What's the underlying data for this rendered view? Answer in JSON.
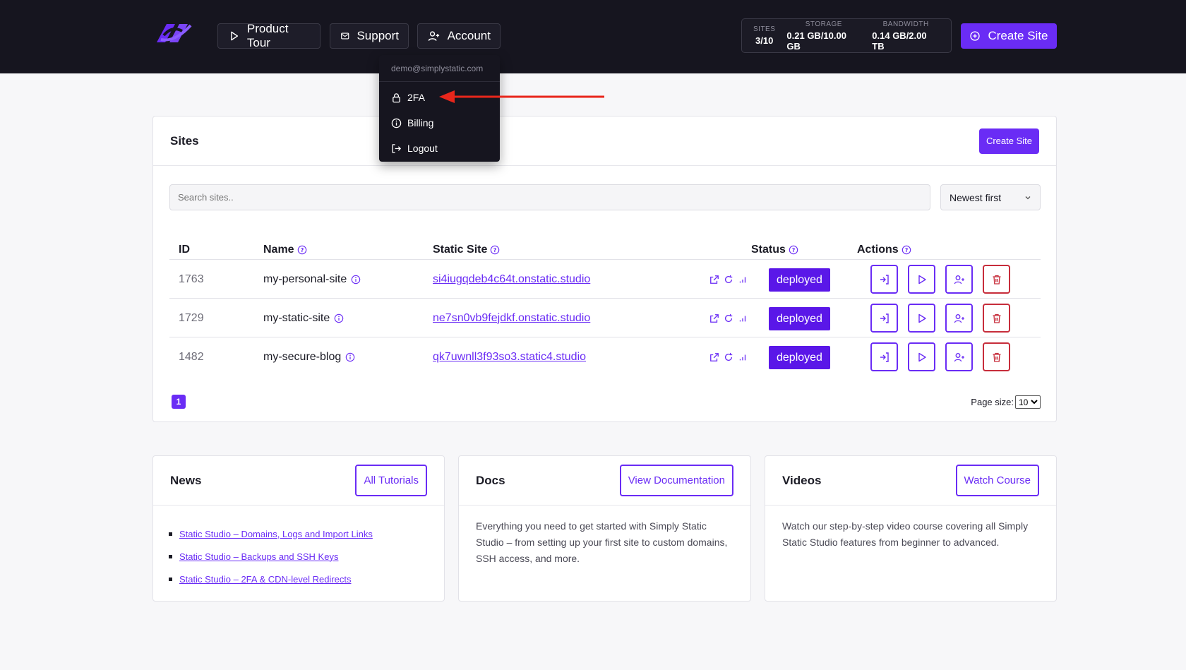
{
  "header": {
    "nav": [
      {
        "label": "Product Tour",
        "icon": "play-icon"
      },
      {
        "label": "Support",
        "icon": "mail-icon"
      },
      {
        "label": "Account",
        "icon": "user-plus-icon"
      }
    ],
    "stats": [
      {
        "label": "SITES",
        "value": "3/10"
      },
      {
        "label": "STORAGE",
        "value": "0.21 GB/10.00 GB"
      },
      {
        "label": "BANDWIDTH",
        "value": "0.14 GB/2.00 TB"
      }
    ],
    "create_label": "Create Site"
  },
  "account_menu": {
    "email": "demo@simplystatic.com",
    "items": [
      {
        "label": "2FA",
        "icon": "lock-icon"
      },
      {
        "label": "Billing",
        "icon": "info-icon"
      },
      {
        "label": "Logout",
        "icon": "logout-icon"
      }
    ]
  },
  "sites": {
    "title": "Sites",
    "create_label": "Create Site",
    "search_placeholder": "Search sites..",
    "sort_value": "Newest first",
    "columns": [
      "ID",
      "Name",
      "Static Site",
      "Status",
      "Actions"
    ],
    "rows": [
      {
        "id": "1763",
        "name": "my-personal-site",
        "url": "si4iugqdeb4c64t.onstatic.studio",
        "status": "deployed"
      },
      {
        "id": "1729",
        "name": "my-static-site",
        "url": "ne7sn0vb9fejdkf.onstatic.studio",
        "status": "deployed"
      },
      {
        "id": "1482",
        "name": "my-secure-blog",
        "url": "qk7uwnll3f93so3.static4.studio",
        "status": "deployed"
      }
    ],
    "page": "1",
    "page_size_label": "Page size:",
    "page_size_value": "10"
  },
  "news": {
    "title": "News",
    "button": "All Tutorials",
    "items": [
      "Static Studio – Domains, Logs and Import Links",
      "Static Studio – Backups and SSH Keys",
      "Static Studio – 2FA & CDN-level Redirects"
    ]
  },
  "docs": {
    "title": "Docs",
    "button": "View Documentation",
    "text": "Everything you need to get started with Simply Static Studio – from setting up your first site to custom domains, SSH access, and more."
  },
  "videos": {
    "title": "Videos",
    "button": "Watch Course",
    "text": "Watch our step-by-step video course covering all Simply Static Studio features from beginner to advanced."
  },
  "colors": {
    "accent": "#6a2cf5",
    "header_bg": "#16151f",
    "danger": "#c72d3b",
    "arrow": "#e8261b"
  }
}
